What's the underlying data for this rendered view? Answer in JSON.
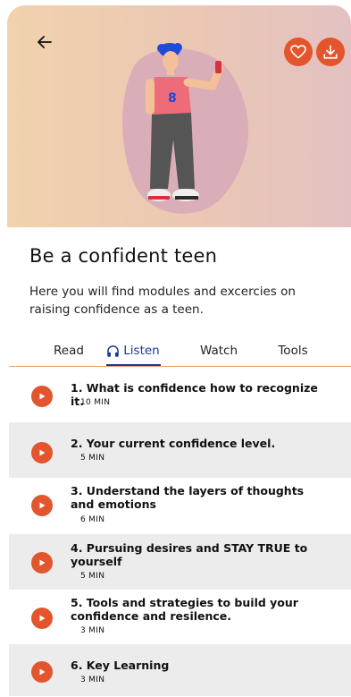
{
  "header": {
    "back_icon": "arrow-left-icon",
    "favorite_icon": "heart-outline-icon",
    "download_icon": "download-icon",
    "accent_color": "#e2552d"
  },
  "course": {
    "title": "Be a confident teen",
    "description": "Here you will find modules and excercies on raising confidence as a teen."
  },
  "tabs": [
    {
      "label": "Read",
      "active": false
    },
    {
      "label": "Listen",
      "active": true,
      "icon": "headphones-icon"
    },
    {
      "label": "Watch",
      "active": false
    },
    {
      "label": "Tools",
      "active": false
    }
  ],
  "lessons": [
    {
      "title": "1. What is confidence how to recognize it.",
      "duration": "10 MIN"
    },
    {
      "title": "2. Your current confidence level.",
      "duration": "5 MIN"
    },
    {
      "title": "3. Understand the layers of thoughts and emotions",
      "duration": "6 MIN"
    },
    {
      "title": "4. Pursuing desires and STAY TRUE to yourself",
      "duration": "5 MIN"
    },
    {
      "title": "5. Tools and strategies to build your confidence and resilence.",
      "duration": "3 MIN"
    },
    {
      "title": "6. Key Learning",
      "duration": "3 MIN"
    }
  ]
}
